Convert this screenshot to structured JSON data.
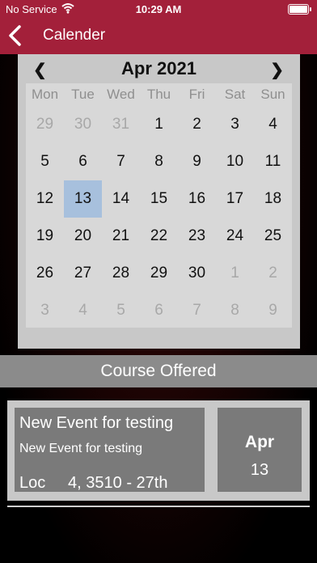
{
  "status_bar": {
    "carrier": "No Service",
    "time": "10:29 AM",
    "icons": [
      "wifi-icon",
      "battery-icon"
    ]
  },
  "nav": {
    "title": "Calender",
    "back_icon": "chevron-left-icon"
  },
  "calendar": {
    "month_label": "Apr 2021",
    "prev_glyph": "❮",
    "next_glyph": "❯",
    "weekdays": [
      "Mon",
      "Tue",
      "Wed",
      "Thu",
      "Fri",
      "Sat",
      "Sun"
    ],
    "days": [
      {
        "label": "29",
        "muted": true
      },
      {
        "label": "30",
        "muted": true
      },
      {
        "label": "31",
        "muted": true
      },
      {
        "label": "1"
      },
      {
        "label": "2"
      },
      {
        "label": "3"
      },
      {
        "label": "4"
      },
      {
        "label": "5"
      },
      {
        "label": "6"
      },
      {
        "label": "7"
      },
      {
        "label": "8"
      },
      {
        "label": "9"
      },
      {
        "label": "10"
      },
      {
        "label": "11"
      },
      {
        "label": "12"
      },
      {
        "label": "13",
        "selected": true
      },
      {
        "label": "14"
      },
      {
        "label": "15"
      },
      {
        "label": "16"
      },
      {
        "label": "17"
      },
      {
        "label": "18"
      },
      {
        "label": "19"
      },
      {
        "label": "20"
      },
      {
        "label": "21"
      },
      {
        "label": "22"
      },
      {
        "label": "23"
      },
      {
        "label": "24"
      },
      {
        "label": "25"
      },
      {
        "label": "26"
      },
      {
        "label": "27"
      },
      {
        "label": "28"
      },
      {
        "label": "29"
      },
      {
        "label": "30"
      },
      {
        "label": "1",
        "muted": true
      },
      {
        "label": "2",
        "muted": true
      },
      {
        "label": "3",
        "muted": true
      },
      {
        "label": "4",
        "muted": true
      },
      {
        "label": "5",
        "muted": true
      },
      {
        "label": "6",
        "muted": true
      },
      {
        "label": "7",
        "muted": true
      },
      {
        "label": "8",
        "muted": true
      },
      {
        "label": "9",
        "muted": true
      }
    ],
    "selected_color": "#a7c0dd"
  },
  "course_section": {
    "title": "Course Offered"
  },
  "events": [
    {
      "title": "New Event for testing",
      "subtitle": "New Event for testing",
      "location": "Loc     4, 3510 - 27th",
      "month": "Apr",
      "day": "13"
    }
  ],
  "colors": {
    "brand": "#a3203a",
    "bar_gray": "#8b8b8b",
    "card_gray": "#7a7a7a"
  }
}
